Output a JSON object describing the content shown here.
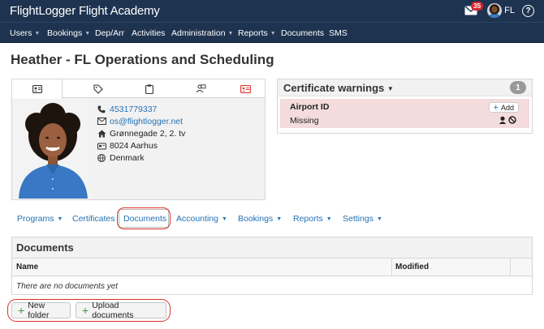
{
  "app": {
    "brand": "FlightLogger Flight Academy",
    "notifications_count": "35",
    "user_initials": "FL",
    "help_label": "?"
  },
  "nav": {
    "items": [
      {
        "label": "Users",
        "caret": true
      },
      {
        "label": "Bookings",
        "caret": true
      },
      {
        "label": "Dep/Arr",
        "caret": false
      },
      {
        "label": "Activities",
        "caret": false
      },
      {
        "label": "Administration",
        "caret": true
      },
      {
        "label": "Reports",
        "caret": true
      },
      {
        "label": "Documents",
        "caret": false
      },
      {
        "label": "SMS",
        "caret": false
      }
    ]
  },
  "page": {
    "title": "Heather - FL Operations and Scheduling"
  },
  "profile": {
    "tabs": [
      "contact-card-icon",
      "tag-icon",
      "clipboard-icon",
      "badge-person-icon",
      "id-card-icon"
    ],
    "phone": "4531779337",
    "email": "os@flightlogger.net",
    "street": "Grønnegade 2, 2. tv",
    "city": "8024 Aarhus",
    "country": "Denmark"
  },
  "certificates": {
    "title": "Certificate warnings",
    "count": "1",
    "warning_name": "Airport ID",
    "warning_status": "Missing",
    "add_label": "Add"
  },
  "subnav": {
    "items": [
      {
        "label": "Programs",
        "caret": true
      },
      {
        "label": "Certificates",
        "caret": false
      },
      {
        "label": "Documents",
        "caret": false,
        "active": true
      },
      {
        "label": "Accounting",
        "caret": true
      },
      {
        "label": "Bookings",
        "caret": true
      },
      {
        "label": "Reports",
        "caret": true
      },
      {
        "label": "Settings",
        "caret": true
      }
    ]
  },
  "documents": {
    "title": "Documents",
    "col_name": "Name",
    "col_modified": "Modified",
    "empty_message": "There are no documents yet",
    "new_folder_label": "New folder",
    "upload_label": "Upload documents"
  },
  "colors": {
    "header_bg": "#1e3350",
    "link": "#2472b5",
    "warning_bg": "#f4dcdc",
    "highlight": "#d9302c",
    "add_green": "#3a9a3a"
  }
}
